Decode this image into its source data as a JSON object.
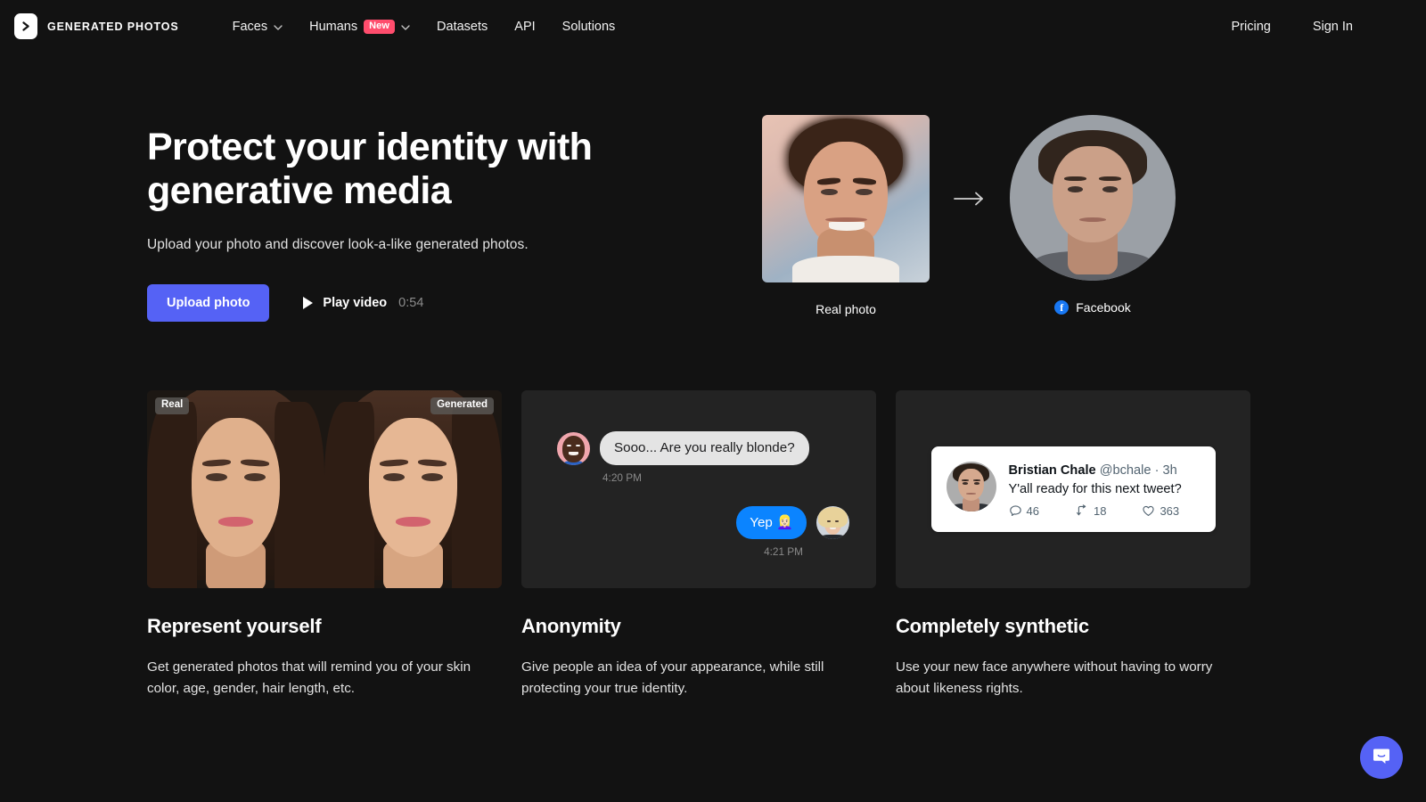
{
  "theme": {
    "page_bg": "#121212",
    "card_bg": "#232323",
    "accent": "#5562F5",
    "badge_new": "#FF4D6D",
    "facebook_blue": "#1877F2",
    "imessage_blue": "#0B84FF"
  },
  "navbar": {
    "brand": "GENERATED PHOTOS",
    "logo_icon": "chevron-right-logo-icon",
    "links": [
      {
        "label": "Faces",
        "has_dropdown": true,
        "badge": null
      },
      {
        "label": "Humans",
        "has_dropdown": true,
        "badge": "New"
      },
      {
        "label": "Datasets",
        "has_dropdown": false,
        "badge": null
      },
      {
        "label": "API",
        "has_dropdown": false,
        "badge": null
      },
      {
        "label": "Solutions",
        "has_dropdown": false,
        "badge": null
      }
    ],
    "right_links": [
      {
        "label": "Pricing"
      },
      {
        "label": "Sign In"
      }
    ]
  },
  "hero": {
    "title": "Protect your identity with generative media",
    "subtitle": "Upload your photo and discover look-a-like generated photos.",
    "upload_button": "Upload photo",
    "play_label": "Play video",
    "play_duration": "0:54",
    "play_icon": "play-triangle-icon",
    "arrow_icon": "arrow-right-icon",
    "before": {
      "caption": "Real photo",
      "icon": null
    },
    "after": {
      "caption": "Facebook",
      "icon": "facebook-icon"
    }
  },
  "features": [
    {
      "title": "Represent yourself",
      "body": "Get generated photos that will remind you of your skin color, age, gender, hair length, etc.",
      "media_type": "comparison",
      "tag_left": "Real",
      "tag_right": "Generated"
    },
    {
      "title": "Anonymity",
      "body": "Give people an idea of your appearance, while still protecting your true identity.",
      "media_type": "chat",
      "chat": {
        "incoming": {
          "text": "Sooo... Are you really blonde?",
          "time": "4:20 PM",
          "avatar": "avatar-dark-smiling"
        },
        "outgoing": {
          "text": "Yep 👱🏻‍♀️",
          "time": "4:21 PM",
          "avatar": "avatar-blonde-woman"
        }
      }
    },
    {
      "title": "Completely synthetic",
      "body": "Use your new face anywhere without having to worry about likeness rights.",
      "media_type": "tweet",
      "tweet": {
        "name": "Bristian Chale",
        "handle": "@bchale",
        "separator": "·",
        "time": "3h",
        "text": "Y'all ready for this next tweet?",
        "avatar": "avatar-synthetic-man",
        "stats": [
          {
            "icon": "reply-icon",
            "value": "46"
          },
          {
            "icon": "retweet-icon",
            "value": "18"
          },
          {
            "icon": "heart-icon",
            "value": "363"
          }
        ]
      }
    }
  ],
  "widgets": {
    "intercom": {
      "icon": "intercom-chat-icon",
      "label": "Open chat"
    }
  }
}
